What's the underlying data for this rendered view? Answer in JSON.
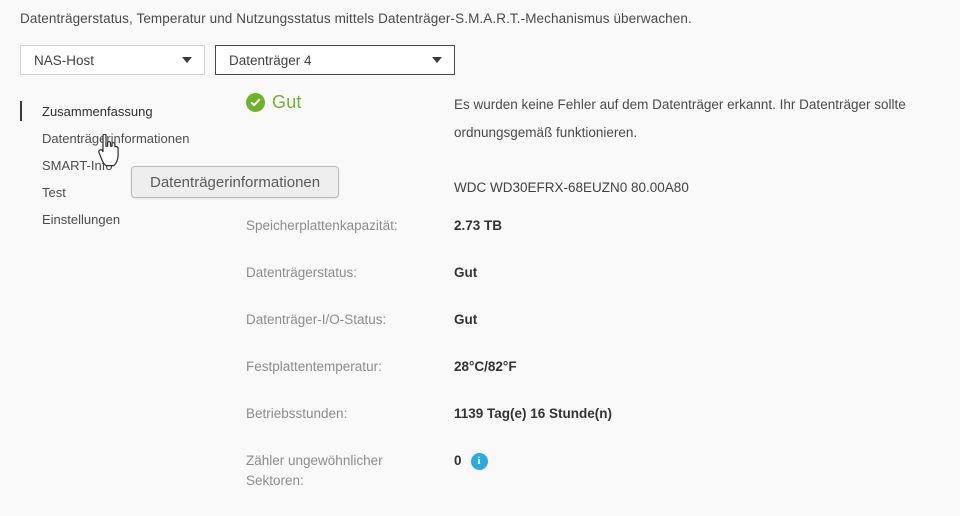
{
  "page": {
    "description": "Datenträgerstatus, Temperatur und Nutzungsstatus mittels Datenträger-S.M.A.R.T.-Mechanismus überwachen."
  },
  "selectors": {
    "host": {
      "value": "NAS-Host",
      "caret_icon": "chevron-down-icon"
    },
    "volume": {
      "value": "Datenträger 4",
      "caret_icon": "chevron-down-icon"
    }
  },
  "sidebar": {
    "items": [
      {
        "label": "Zusammenfassung"
      },
      {
        "label": "Datenträgerinformationen"
      },
      {
        "label": "SMART-Info"
      },
      {
        "label": "Test"
      },
      {
        "label": "Einstellungen"
      }
    ]
  },
  "tooltip": {
    "text": "Datenträgerinformationen"
  },
  "main": {
    "status": {
      "icon": "check-circle-icon",
      "text": "Gut",
      "color": "#6fb32b"
    },
    "description": "Es wurden keine Fehler auf dem Datenträger erkannt. Ihr Datenträger sollte ordnungsgemäß funktionieren.",
    "model": "WDC WD30EFRX-68EUZN0 80.00A80",
    "details": [
      {
        "label": "Speicherplattenkapazität:",
        "value": "2.73 TB"
      },
      {
        "label": "Datenträgerstatus:",
        "value": "Gut"
      },
      {
        "label": "Datenträger-I/O-Status:",
        "value": "Gut"
      },
      {
        "label": "Festplattentemperatur:",
        "value": "28°C/82°F"
      },
      {
        "label": "Betriebsstunden:",
        "value": "1139 Tag(e) 16 Stunde(n)"
      },
      {
        "label": "Zähler ungewöhnlicher Sektoren:",
        "value": "0",
        "info_icon": "info-icon"
      }
    ]
  },
  "colors": {
    "background": "#f9f9f9",
    "status_green": "#6fb32b",
    "info_blue": "#29ABE2"
  }
}
